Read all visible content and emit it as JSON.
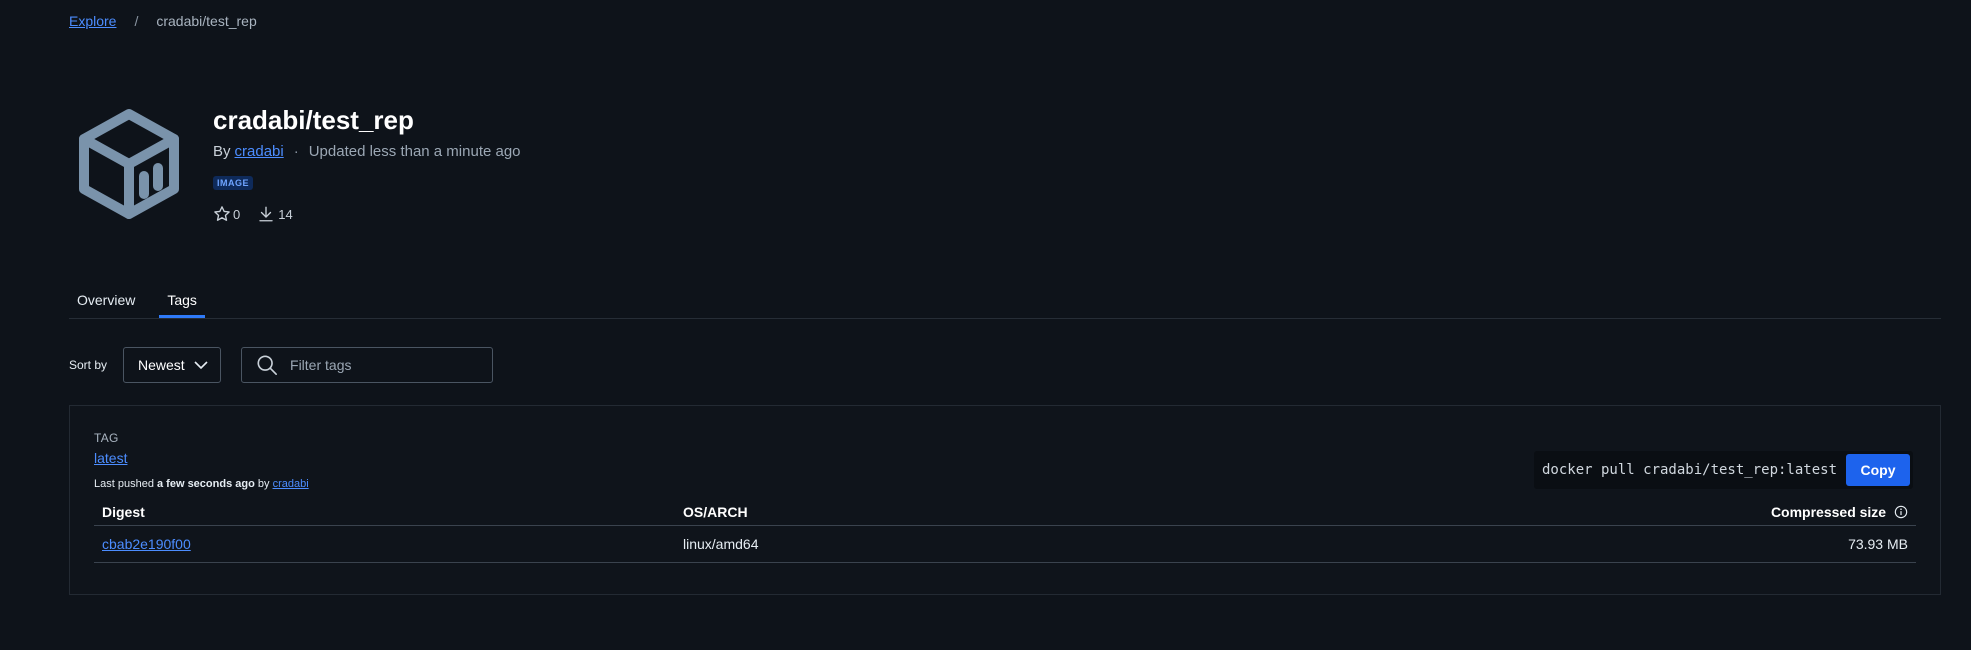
{
  "breadcrumb": {
    "root": "Explore",
    "separator": "/",
    "current": "cradabi/test_rep"
  },
  "repo": {
    "title": "cradabi/test_rep",
    "by_prefix": "By",
    "author": "cradabi",
    "dot": "·",
    "updated": "Updated less than a minute ago",
    "badge": "IMAGE",
    "stars": "0",
    "pulls": "14",
    "logo_icon": "cube-icon"
  },
  "tabs": [
    {
      "label": "Overview",
      "active": false
    },
    {
      "label": "Tags",
      "active": true
    }
  ],
  "toolbar": {
    "sort_label": "Sort by",
    "sort_value": "Newest",
    "filter_placeholder": "Filter tags"
  },
  "tag": {
    "section_label": "TAG",
    "name": "latest",
    "pushed_prefix": "Last pushed",
    "pushed_when": "a few seconds ago",
    "pushed_by_prefix": "by",
    "pushed_by": "cradabi",
    "pull_command": "docker pull cradabi/test_rep:latest",
    "copy_label": "Copy",
    "table": {
      "headers": {
        "digest": "Digest",
        "os_arch": "OS/ARCH",
        "size": "Compressed size"
      },
      "rows": [
        {
          "digest": "cbab2e190f00",
          "os_arch": "linux/amd64",
          "size": "73.93 MB"
        }
      ]
    }
  },
  "colors": {
    "accent": "#1d63ed",
    "link": "#4c8dff",
    "background": "#0e131a"
  }
}
